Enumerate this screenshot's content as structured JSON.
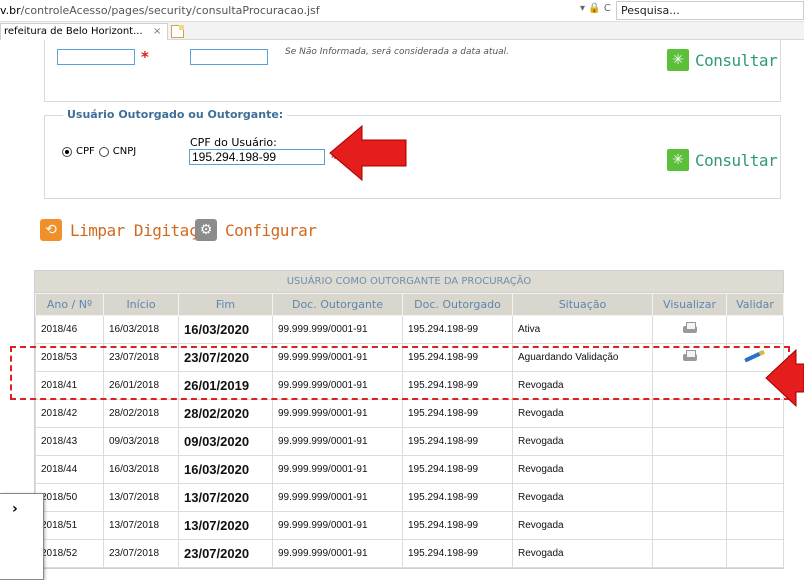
{
  "browser": {
    "url_prefix": "v.br",
    "url_path": "/controleAcesso/pages/security/consultaProcuracao.jsf",
    "controls": "▾ 🔒 C",
    "search_placeholder": "Pesquisa...",
    "tab_title": "refeitura de Belo Horizont...",
    "tab_close": "×"
  },
  "date_section": {
    "required_mark": "*",
    "hint": "Se Não Informada, será considerada a data atual.",
    "consultar_label": "Consultar"
  },
  "user_section": {
    "legend": "Usuário Outorgado ou Outorgante:",
    "radio_cpf": "CPF",
    "radio_cnpj": "CNPJ",
    "cpf_label": "CPF do Usuário:",
    "cpf_value": "195.294.198-99",
    "required_mark": "*",
    "consultar_label": "Consultar"
  },
  "actions": {
    "limpar": "Limpar Digitação",
    "configurar": "Configurar"
  },
  "table": {
    "title": "USUÁRIO COMO OUTORGANTE DA PROCURAÇÃO",
    "headers": [
      "Ano / Nº",
      "Início",
      "Fim",
      "Doc. Outorgante",
      "Doc. Outorgado",
      "Situação",
      "Visualizar",
      "Validar"
    ],
    "rows": [
      {
        "ano": "2018/46",
        "inicio": "16/03/2018",
        "fim": "16/03/2020",
        "outorgante": "99.999.999/0001-91",
        "outorgado": "195.294.198-99",
        "situacao": "Ativa",
        "visualizar": true,
        "validar": false
      },
      {
        "ano": "2018/53",
        "inicio": "23/07/2018",
        "fim": "23/07/2020",
        "outorgante": "99.999.999/0001-91",
        "outorgado": "195.294.198-99",
        "situacao": "Aguardando Validação",
        "visualizar": true,
        "validar": true
      },
      {
        "ano": "2018/41",
        "inicio": "26/01/2018",
        "fim": "26/01/2019",
        "outorgante": "99.999.999/0001-91",
        "outorgado": "195.294.198-99",
        "situacao": "Revogada",
        "visualizar": false,
        "validar": false
      },
      {
        "ano": "2018/42",
        "inicio": "28/02/2018",
        "fim": "28/02/2020",
        "outorgante": "99.999.999/0001-91",
        "outorgado": "195.294.198-99",
        "situacao": "Revogada",
        "visualizar": false,
        "validar": false
      },
      {
        "ano": "2018/43",
        "inicio": "09/03/2018",
        "fim": "09/03/2020",
        "outorgante": "99.999.999/0001-91",
        "outorgado": "195.294.198-99",
        "situacao": "Revogada",
        "visualizar": false,
        "validar": false
      },
      {
        "ano": "2018/44",
        "inicio": "16/03/2018",
        "fim": "16/03/2020",
        "outorgante": "99.999.999/0001-91",
        "outorgado": "195.294.198-99",
        "situacao": "Revogada",
        "visualizar": false,
        "validar": false
      },
      {
        "ano": "2018/50",
        "inicio": "13/07/2018",
        "fim": "13/07/2020",
        "outorgante": "99.999.999/0001-91",
        "outorgado": "195.294.198-99",
        "situacao": "Revogada",
        "visualizar": false,
        "validar": false
      },
      {
        "ano": "2018/51",
        "inicio": "13/07/2018",
        "fim": "13/07/2020",
        "outorgante": "99.999.999/0001-91",
        "outorgado": "195.294.198-99",
        "situacao": "Revogada",
        "visualizar": false,
        "validar": false
      },
      {
        "ano": "2018/52",
        "inicio": "23/07/2018",
        "fim": "23/07/2020",
        "outorgante": "99.999.999/0001-91",
        "outorgado": "195.294.198-99",
        "situacao": "Revogada",
        "visualizar": false,
        "validar": false
      }
    ]
  },
  "left_panel": {
    "text": "›"
  },
  "colors": {
    "accent_green": "#2f9a76",
    "accent_orange": "#d2691e",
    "annotation_red": "#e02020",
    "header_blue": "#5d86ae"
  }
}
